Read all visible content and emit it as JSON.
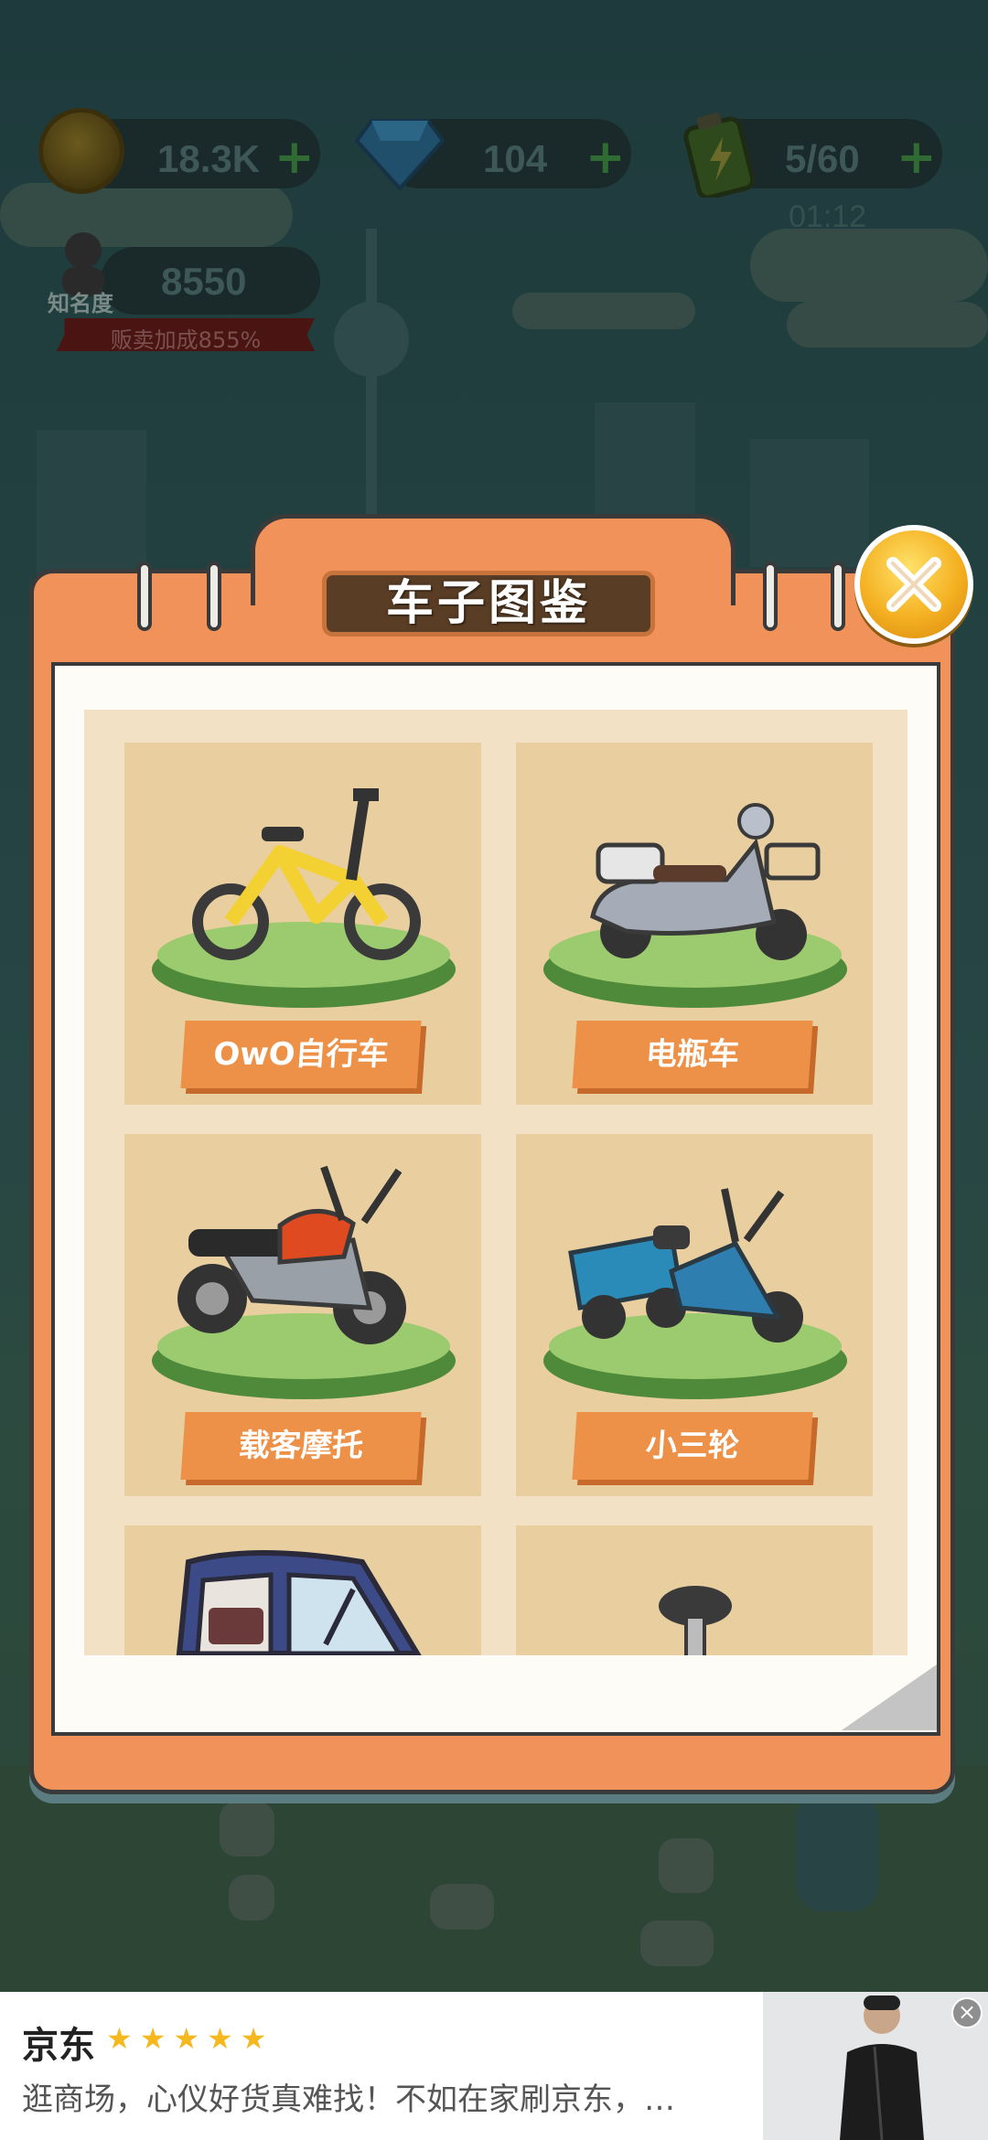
{
  "hud": {
    "coins": "18.3K",
    "gems": "104",
    "energy": "5/60",
    "energy_timer": "01:12",
    "fame_label": "知名度",
    "fame_value": "8550",
    "sell_bonus": "贩卖加成855%"
  },
  "modal": {
    "title": "车子图鉴",
    "vehicles": [
      {
        "label": "OwO自行车",
        "icon": "yellow-bicycle-icon"
      },
      {
        "label": "电瓶车",
        "icon": "scooter-icon"
      },
      {
        "label": "载客摩托",
        "icon": "motorcycle-icon"
      },
      {
        "label": "小三轮",
        "icon": "tricycle-icon"
      },
      {
        "label": "",
        "icon": "covered-tricycle-icon"
      },
      {
        "label": "",
        "icon": "vehicle-seat-icon"
      }
    ]
  },
  "ad": {
    "title": "京东",
    "rating_stars": "★★★★★",
    "description": "逛商场，心仪好货真难找！不如在家刷京东，…",
    "close_symbol": "×"
  },
  "colors": {
    "accent_orange": "#ee9148",
    "frame_orange": "#f0925a",
    "card_bg": "#e9ce9f",
    "close_gold": "#f4b021"
  }
}
